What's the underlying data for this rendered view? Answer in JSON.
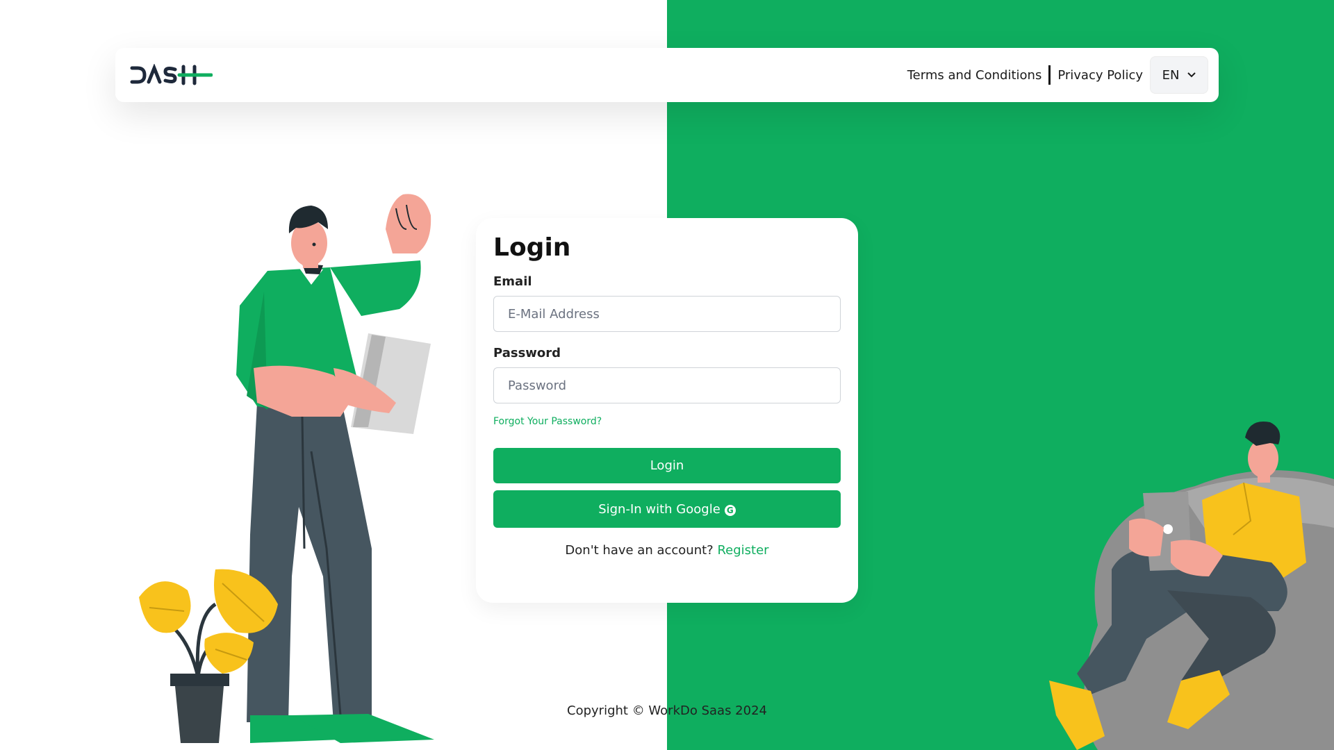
{
  "header": {
    "logo_alt": "DASH",
    "terms_label": "Terms and Conditions",
    "privacy_label": "Privacy Policy",
    "language": "EN"
  },
  "login": {
    "title": "Login",
    "email_label": "Email",
    "email_placeholder": "E-Mail Address",
    "password_label": "Password",
    "password_placeholder": "Password",
    "forgot_label": "Forgot Your Password?",
    "login_button": "Login",
    "google_button": "Sign-In with Google",
    "no_account_text": "Don't have an account?",
    "register_label": "Register"
  },
  "footer": {
    "copyright": "Copyright © WorkDo Saas 2024"
  },
  "colors": {
    "primary": "#0fae5f",
    "background_left": "#ffffff",
    "background_right": "#0fae5f"
  },
  "icons": [
    "dash-logo",
    "chevron-down-icon",
    "google-icon",
    "man-with-tablet-illustration",
    "man-on-beanbag-illustration",
    "monstera-plant-illustration"
  ]
}
